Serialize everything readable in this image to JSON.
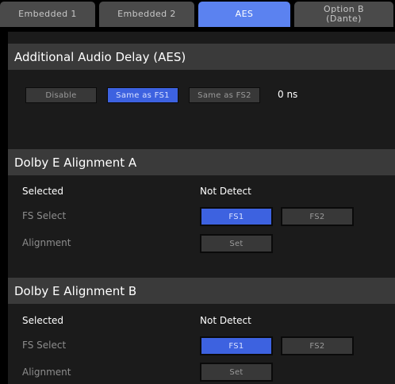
{
  "tabs": [
    {
      "label": "Embedded 1",
      "sub": "",
      "active": false
    },
    {
      "label": "Embedded 2",
      "sub": "",
      "active": false
    },
    {
      "label": "AES",
      "sub": "",
      "active": true
    },
    {
      "label": "Option B",
      "sub": "(Dante)",
      "active": false
    }
  ],
  "aes_delay": {
    "title": "Additional Audio Delay (AES)",
    "buttons": [
      {
        "label": "Disable",
        "selected": false
      },
      {
        "label": "Same as FS1",
        "selected": true
      },
      {
        "label": "Same as FS2",
        "selected": false
      }
    ],
    "value": "0 ns"
  },
  "dolby_a": {
    "title": "Dolby E Alignment A",
    "selected_label": "Selected",
    "selected_value": "Not Detect",
    "fs_select_label": "FS Select",
    "fs_options": [
      {
        "label": "FS1",
        "selected": true
      },
      {
        "label": "FS2",
        "selected": false
      }
    ],
    "alignment_label": "Alignment",
    "set_label": "Set"
  },
  "dolby_b": {
    "title": "Dolby E Alignment B",
    "selected_label": "Selected",
    "selected_value": "Not Detect",
    "fs_select_label": "FS Select",
    "fs_options": [
      {
        "label": "FS1",
        "selected": true
      },
      {
        "label": "FS2",
        "selected": false
      }
    ],
    "alignment_label": "Alignment",
    "set_label": "Set"
  },
  "colors": {
    "active_tab": "#5b82f0",
    "selected_button": "#3d62e0",
    "header_bg": "#3a3a3a",
    "panel_bg": "#1b1b1b"
  }
}
